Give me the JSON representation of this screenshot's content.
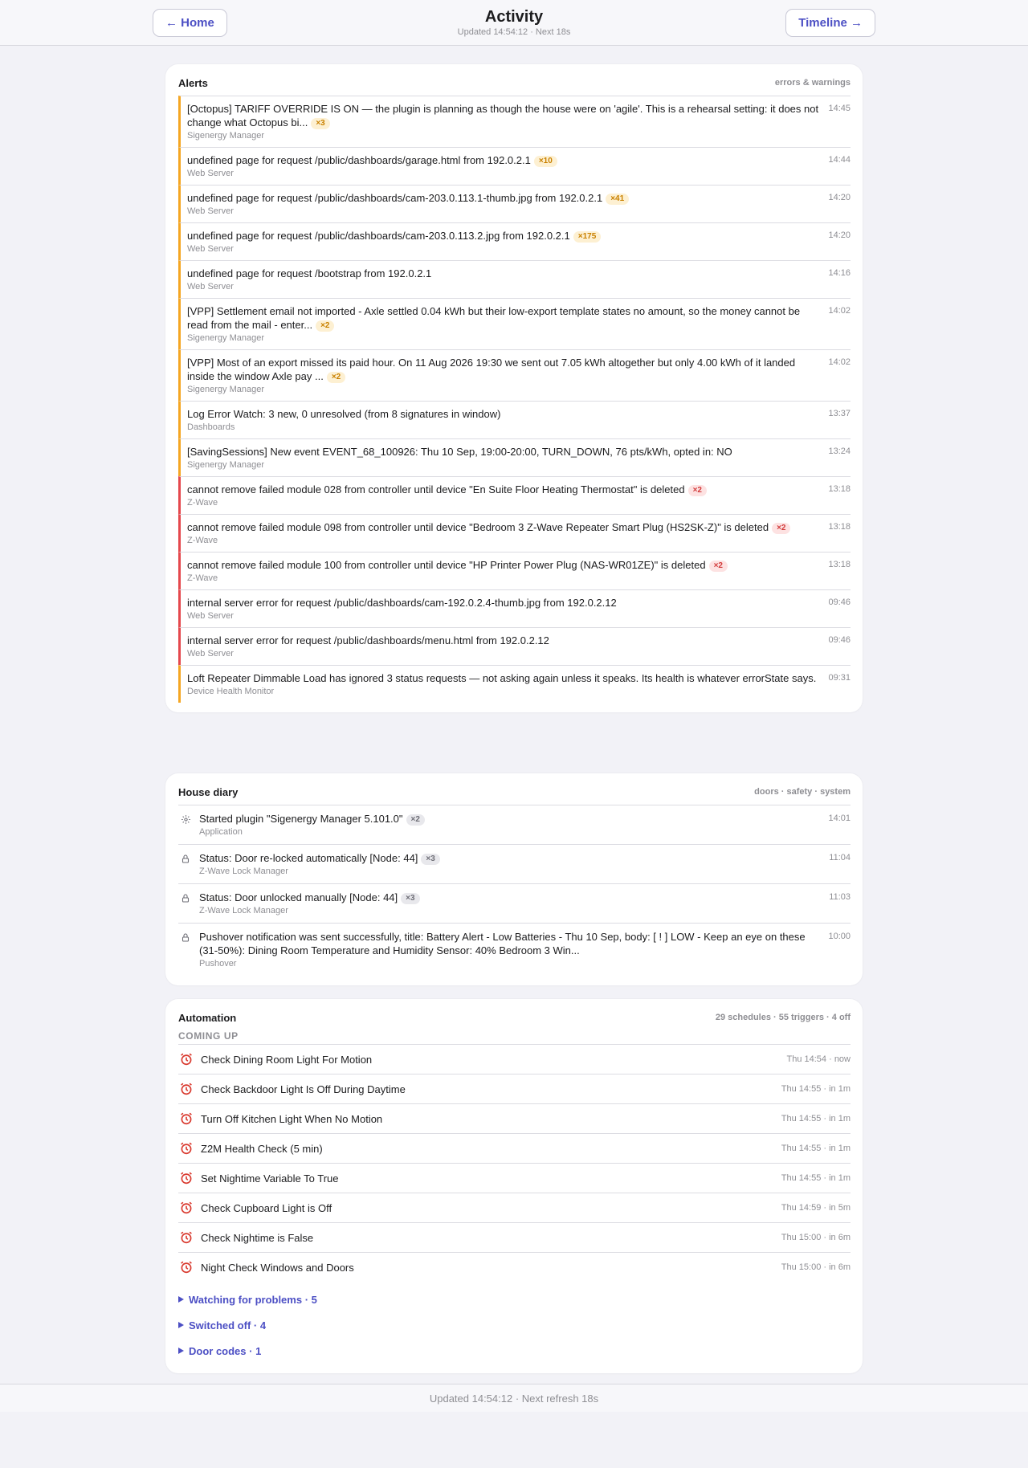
{
  "header": {
    "home_label": "← Home",
    "title": "Activity",
    "subtitle": "Updated 14:54:12 · Next 18s",
    "timeline_label": "Timeline →"
  },
  "alerts": {
    "title": "Alerts",
    "meta": "errors & warnings",
    "items": [
      {
        "level": "warning",
        "message": "[Octopus] TARIFF OVERRIDE IS ON — the plugin is planning as though the house were on 'agile'. This is a rehearsal setting: it does not change what Octopus bi...",
        "count": "×3",
        "source": "Sigenergy Manager",
        "time": "14:45"
      },
      {
        "level": "warning",
        "message": "undefined page for request /public/dashboards/garage.html from 192.0.2.1",
        "count": "×10",
        "source": "Web Server",
        "time": "14:44"
      },
      {
        "level": "warning",
        "message": "undefined page for request /public/dashboards/cam-203.0.113.1-thumb.jpg from 192.0.2.1",
        "count": "×41",
        "source": "Web Server",
        "time": "14:20"
      },
      {
        "level": "warning",
        "message": "undefined page for request /public/dashboards/cam-203.0.113.2.jpg from 192.0.2.1",
        "count": "×175",
        "source": "Web Server",
        "time": "14:20"
      },
      {
        "level": "warning",
        "message": "undefined page for request /bootstrap from 192.0.2.1",
        "count": "",
        "source": "Web Server",
        "time": "14:16"
      },
      {
        "level": "warning",
        "message": "[VPP] Settlement email not imported - Axle settled 0.04 kWh but their low-export template states no amount, so the money cannot be read from the mail - enter...",
        "count": "×2",
        "source": "Sigenergy Manager",
        "time": "14:02"
      },
      {
        "level": "warning",
        "message": "[VPP] Most of an export missed its paid hour. On 11 Aug 2026 19:30 we sent out 7.05 kWh altogether but only 4.00 kWh of it landed inside the window Axle pay ...",
        "count": "×2",
        "source": "Sigenergy Manager",
        "time": "14:02"
      },
      {
        "level": "warning",
        "message": "Log Error Watch: 3 new, 0 unresolved (from 8 signatures in window)",
        "count": "",
        "source": "Dashboards",
        "time": "13:37"
      },
      {
        "level": "warning",
        "message": "[SavingSessions] New event EVENT_68_100926: Thu 10 Sep, 19:00-20:00, TURN_DOWN, 76 pts/kWh, opted in: NO",
        "count": "",
        "source": "Sigenergy Manager",
        "time": "13:24"
      },
      {
        "level": "error",
        "message": "cannot remove failed module 028 from controller until device \"En Suite Floor Heating Thermostat\" is deleted",
        "count": "×2",
        "source": "Z-Wave",
        "time": "13:18"
      },
      {
        "level": "error",
        "message": "cannot remove failed module 098 from controller until device \"Bedroom 3 Z-Wave Repeater Smart Plug (HS2SK-Z)\" is deleted",
        "count": "×2",
        "source": "Z-Wave",
        "time": "13:18"
      },
      {
        "level": "error",
        "message": "cannot remove failed module 100 from controller until device \"HP Printer Power Plug (NAS-WR01ZE)\" is deleted",
        "count": "×2",
        "source": "Z-Wave",
        "time": "13:18"
      },
      {
        "level": "error",
        "message": "internal server error for request /public/dashboards/cam-192.0.2.4-thumb.jpg from 192.0.2.12",
        "count": "",
        "source": "Web Server",
        "time": "09:46"
      },
      {
        "level": "error",
        "message": "internal server error for request /public/dashboards/menu.html from 192.0.2.12",
        "count": "",
        "source": "Web Server",
        "time": "09:46"
      },
      {
        "level": "warning",
        "message": "Loft Repeater Dimmable Load has ignored 3 status requests — not asking again unless it speaks. Its health is whatever errorState says.",
        "count": "",
        "source": "Device Health Monitor",
        "time": "09:31"
      }
    ]
  },
  "diary": {
    "title": "House diary",
    "meta": "doors · safety · system",
    "items": [
      {
        "icon": "gear-icon",
        "message": "Started plugin \"Sigenergy Manager 5.101.0\"",
        "count": "×2",
        "source": "Application",
        "time": "14:01"
      },
      {
        "icon": "lock-icon",
        "message": "Status: Door re-locked automatically [Node: 44]",
        "count": "×3",
        "source": "Z-Wave Lock Manager",
        "time": "11:04"
      },
      {
        "icon": "lock-icon",
        "message": "Status: Door unlocked manually [Node: 44]",
        "count": "×3",
        "source": "Z-Wave Lock Manager",
        "time": "11:03"
      },
      {
        "icon": "lock-icon",
        "message": "Pushover notification was sent successfully, title: Battery Alert - Low Batteries - Thu 10 Sep, body: [ ! ] LOW - Keep an eye on these (31-50%): Dining Room Temperature and Humidity Sensor: 40% Bedroom 3 Win...",
        "count": "",
        "source": "Pushover",
        "time": "10:00"
      }
    ]
  },
  "automation": {
    "title": "Automation",
    "meta": "29 schedules · 55 triggers · 4 off",
    "coming_up_label": "COMING UP",
    "schedules": [
      {
        "name": "Check Dining Room Light For Motion",
        "time": "Thu 14:54 · now"
      },
      {
        "name": "Check Backdoor Light Is Off During Daytime",
        "time": "Thu 14:55 · in 1m"
      },
      {
        "name": "Turn Off Kitchen Light When No Motion",
        "time": "Thu 14:55 · in 1m"
      },
      {
        "name": "Z2M Health Check (5 min)",
        "time": "Thu 14:55 · in 1m"
      },
      {
        "name": "Set Nightime Variable To True",
        "time": "Thu 14:55 · in 1m"
      },
      {
        "name": "Check Cupboard Light is Off",
        "time": "Thu 14:59 · in 5m"
      },
      {
        "name": "Check Nightime is False",
        "time": "Thu 15:00 · in 6m"
      },
      {
        "name": "Night Check Windows and Doors",
        "time": "Thu 15:00 · in 6m"
      }
    ],
    "sections": [
      {
        "label": "Watching for problems · 5"
      },
      {
        "label": "Switched off · 4"
      },
      {
        "label": "Door codes · 1"
      }
    ]
  },
  "footer": {
    "text": "Updated 14:54:12 · Next refresh 18s"
  },
  "colors": {
    "accent": "#4c4fc4",
    "warning": "#f5a623",
    "error": "#e5484d",
    "alarm": "#d93a2f"
  }
}
